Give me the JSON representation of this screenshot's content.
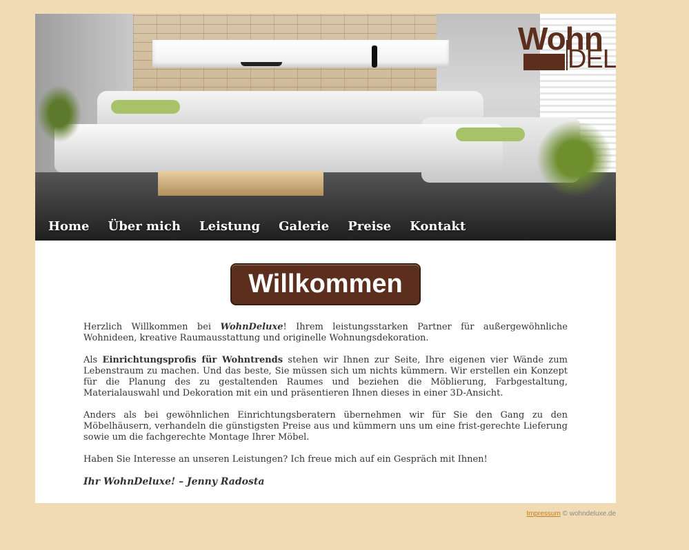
{
  "brand": {
    "logo_top": "Wohn",
    "logo_bottom": "DELUXE!"
  },
  "nav": {
    "items": [
      {
        "label": "Home"
      },
      {
        "label": "Über mich"
      },
      {
        "label": "Leistung"
      },
      {
        "label": "Galerie"
      },
      {
        "label": "Preise"
      },
      {
        "label": "Kontakt"
      }
    ]
  },
  "hero": {
    "image_description_icon": "living-room-photo"
  },
  "main": {
    "welcome_button": "Willkommen",
    "paragraphs": [
      {
        "before": "Herzlich Willkommen bei ",
        "emphasis": "WohnDeluxe",
        "after": "! Ihrem leistungsstarken Partner für außergewöhnliche Wohnideen, kreative Raumausstattung und originelle Wohnungsdekoration."
      },
      {
        "before": "Als ",
        "emphasis": "Einrichtungsprofis für Wohntrends",
        "after": " stehen wir Ihnen zur Seite, Ihre eigenen vier Wände zum Lebenstraum zu machen. Und das beste, Sie müssen sich um nichts kümmern. Wir erstellen ein Konzept für die Planung des zu gestaltenden Raumes und beziehen die Möblierung, Farbgestaltung, Materialauswahl und Dekoration mit ein und präsentieren Ihnen dieses in einer 3D-Ansicht."
      },
      {
        "text": "Anders als bei gewöhnlichen Einrichtungsberatern übernehmen wir für Sie den Gang zu den Möbelhäusern, verhandeln die günstigsten Preise aus und kümmern uns um eine frist-gerechte Lieferung sowie um die fachgerechte Montage Ihrer Möbel."
      },
      {
        "text": "Haben Sie Interesse an unseren Leistungen? Ich freue mich auf ein Gespräch mit Ihnen!"
      }
    ],
    "signature": "Ihr WohnDeluxe! – Jenny Radosta"
  },
  "footer": {
    "impressum_link": "Impressum",
    "copyright": "© wohndeluxe.de"
  },
  "colors": {
    "background": "#f0dbb4",
    "brand_brown": "#5b2e1d",
    "link_orange": "#c47a1e"
  }
}
